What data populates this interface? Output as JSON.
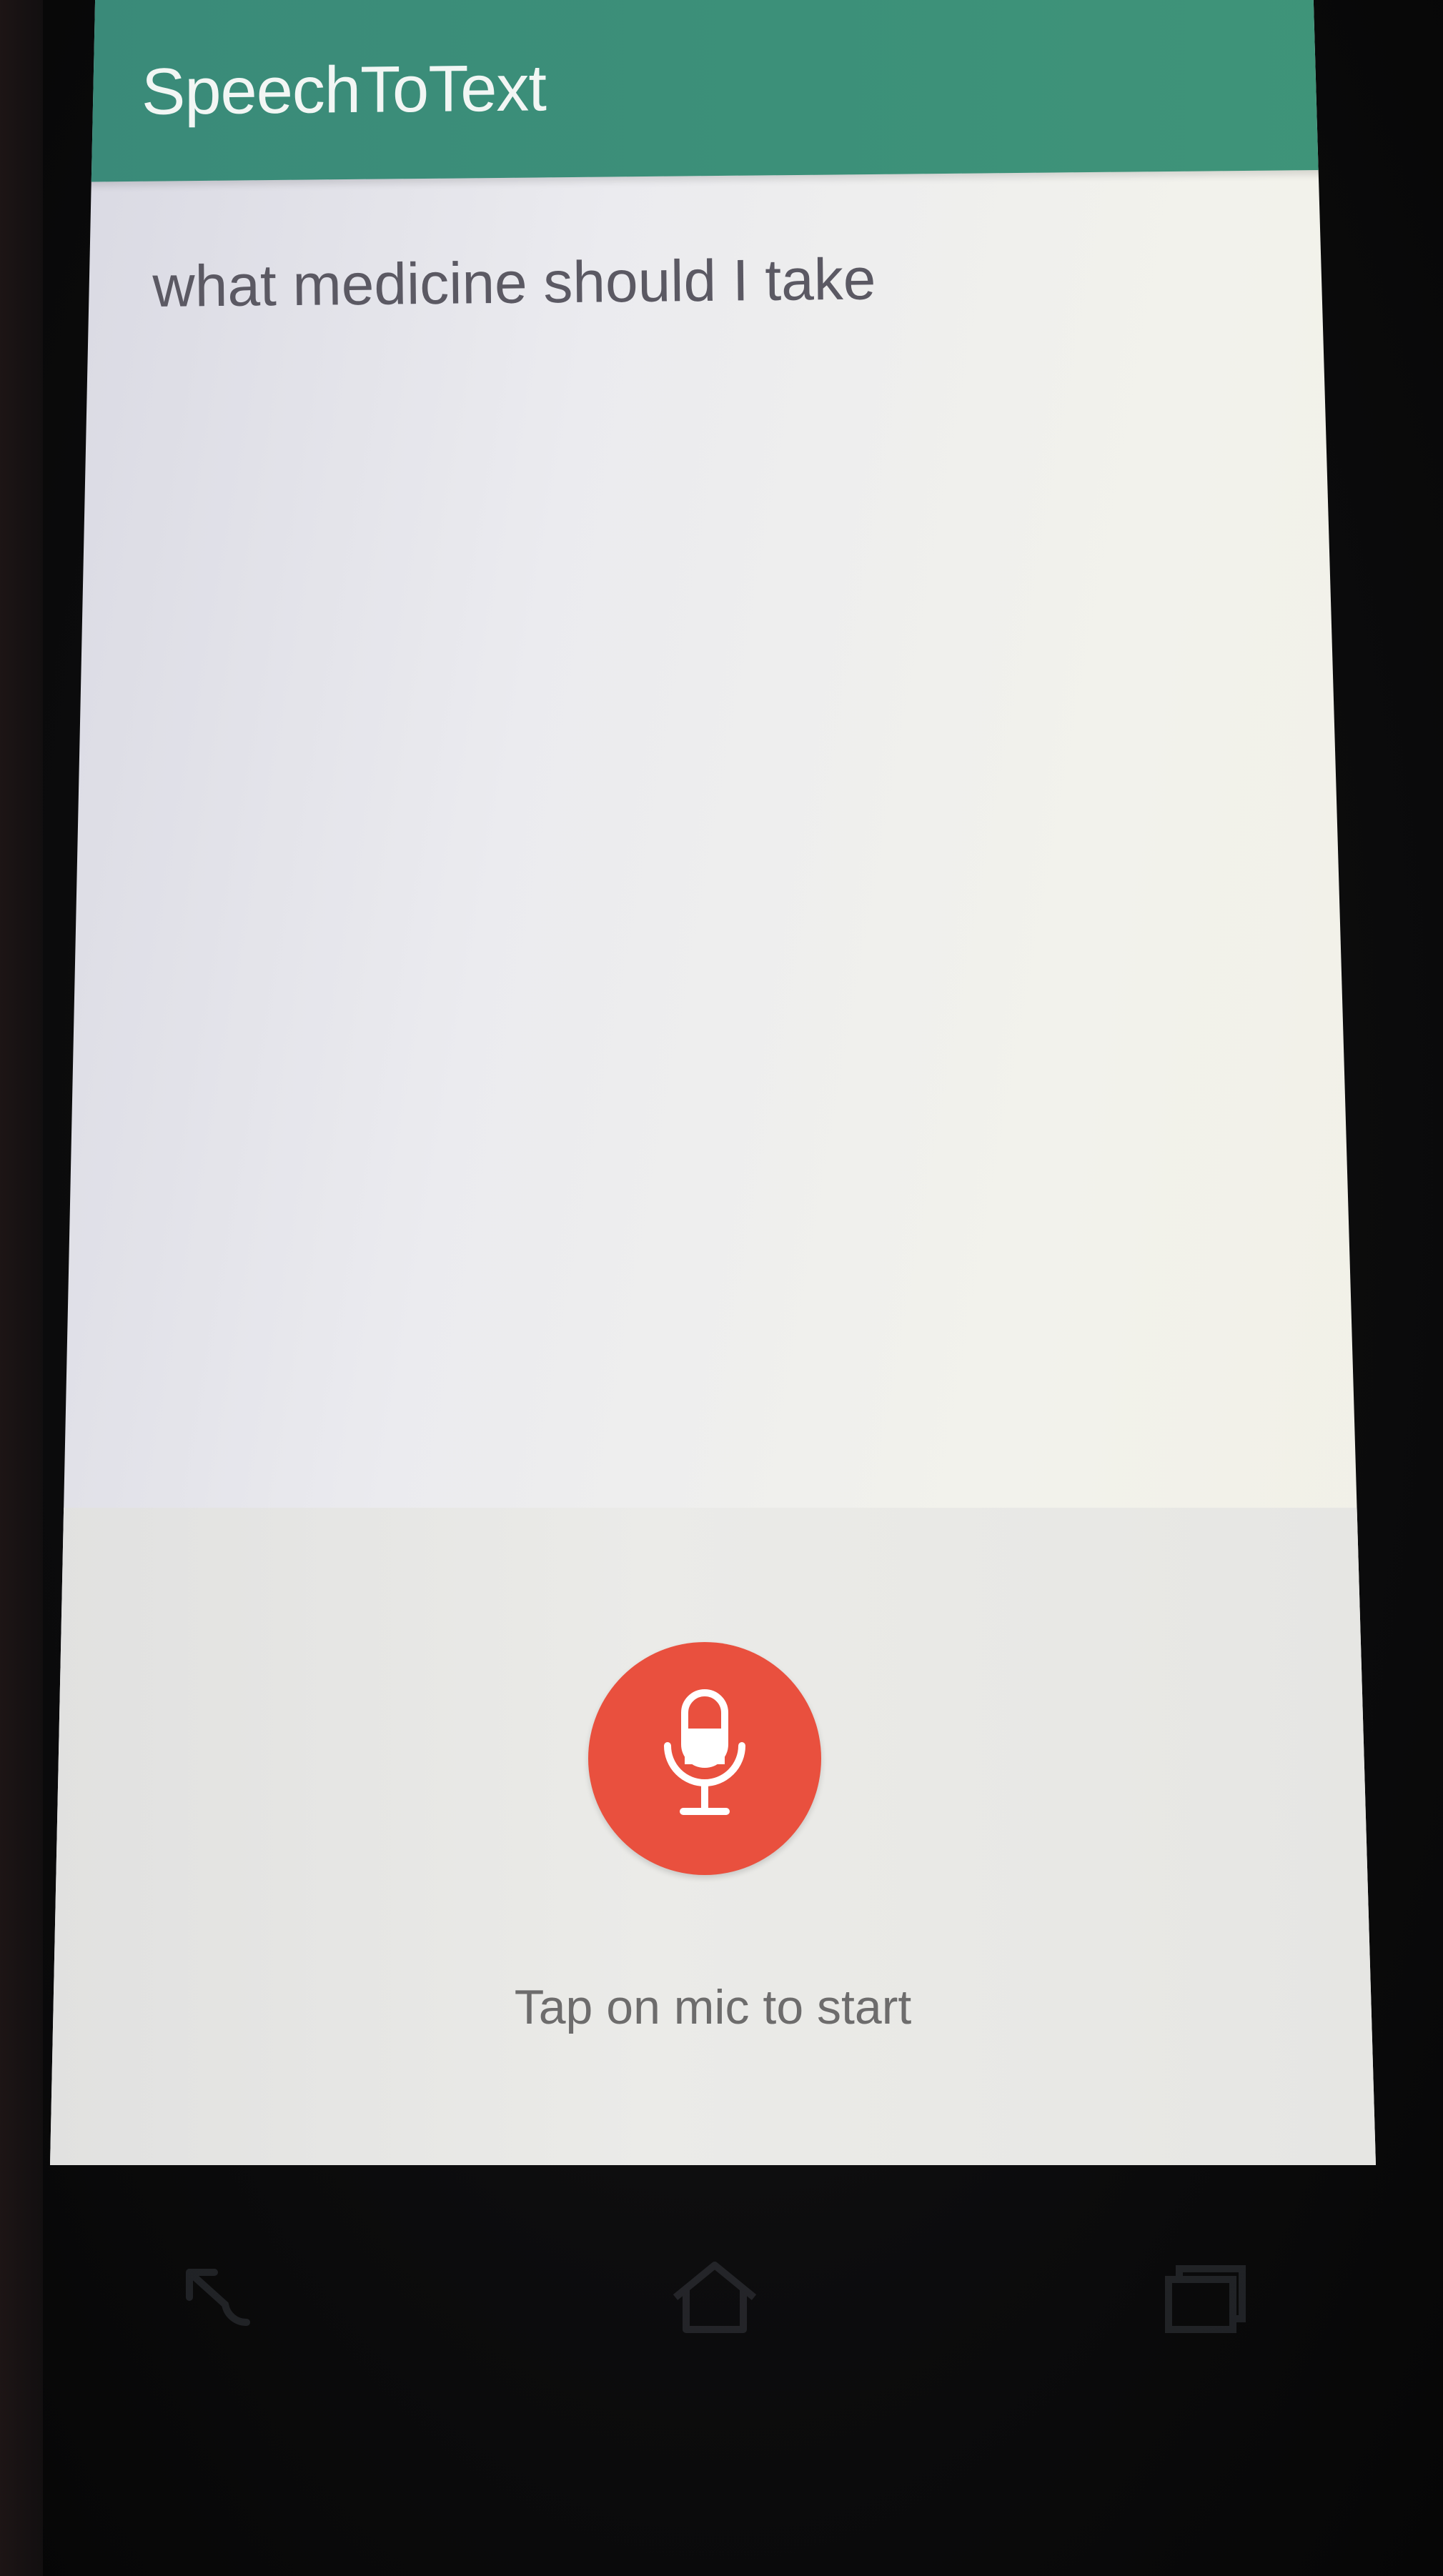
{
  "app_bar": {
    "title": "SpeechToText"
  },
  "main": {
    "recognized_text": "what medicine should I take"
  },
  "mic": {
    "icon": "microphone-icon",
    "hint": "Tap on mic to start"
  },
  "nav_bar": {
    "back_icon": "back-arrow-icon",
    "home_icon": "home-icon",
    "recents_icon": "recents-icon"
  },
  "colors": {
    "app_bar": "#3c9079",
    "mic_button": "#e9503e",
    "recognized_text": "#5b5963",
    "hint_text": "#6d6c6c"
  }
}
